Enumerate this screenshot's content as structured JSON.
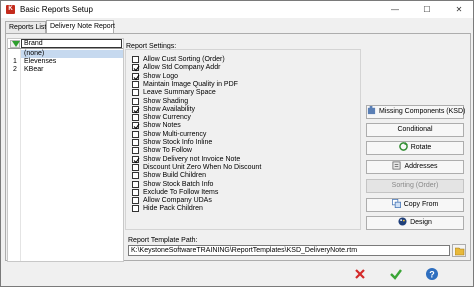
{
  "window": {
    "title": "Basic Reports Setup",
    "min_glyph": "—",
    "max_glyph": "☐",
    "close_glyph": "✕"
  },
  "tabs": [
    {
      "label": "Reports List",
      "active": false
    },
    {
      "label": "Delivery Note Report",
      "active": true
    }
  ],
  "brand_list": {
    "header": "Brand",
    "rows": [
      {
        "num": "",
        "name": "(none)",
        "selected": true
      },
      {
        "num": "1",
        "name": "Elevenses",
        "selected": false
      },
      {
        "num": "2",
        "name": "KBear",
        "selected": false
      }
    ]
  },
  "settings": {
    "group_label": "Report Settings:",
    "options": [
      {
        "label": "Allow Cust Sorting (Order)",
        "checked": false
      },
      {
        "label": "Allow Std Company Addr",
        "checked": true
      },
      {
        "label": "Show Logo",
        "checked": true
      },
      {
        "label": "Maintain Image Quality in PDF",
        "checked": false
      },
      {
        "label": "Leave Summary Space",
        "checked": false
      },
      {
        "label": "Show Shading",
        "checked": false
      },
      {
        "label": "Show Availability",
        "checked": true
      },
      {
        "label": "Show Currency",
        "checked": false
      },
      {
        "label": "Show Notes",
        "checked": true
      },
      {
        "label": "Show Multi-currency",
        "checked": false
      },
      {
        "label": "Show Stock Info Inline",
        "checked": false
      },
      {
        "label": "Show To Follow",
        "checked": false
      },
      {
        "label": "Show Delivery not Invoice Note",
        "checked": true
      },
      {
        "label": "Discount Unit Zero When No Discount",
        "checked": false
      },
      {
        "label": "Show Build Children",
        "checked": false
      },
      {
        "label": "Show Stock Batch Info",
        "checked": false
      },
      {
        "label": "Exclude To Follow Items",
        "checked": false
      },
      {
        "label": "Allow Company UDAs",
        "checked": false
      },
      {
        "label": "Hide Pack Children",
        "checked": false
      }
    ]
  },
  "buttons": {
    "missing_components": "Missing Components (KSD)",
    "conditional": "Conditional",
    "rotate": "Rotate",
    "addresses": "Addresses",
    "sorting": "Sorting (Order)",
    "copy_from": "Copy From",
    "design": "Design"
  },
  "template": {
    "label": "Report Template Path:",
    "path": "K:\\KeystoneSoftwareTRAINING\\ReportTemplates\\KSD_DeliveryNote.rtm"
  },
  "colors": {
    "accent": "#c42b1c",
    "selection": "#c6d9ef",
    "ok_green": "#3aa536",
    "cancel_red": "#d42a2a"
  },
  "icons": {
    "cancel": "cancel-x-icon",
    "ok": "ok-check-icon",
    "help": "help-question-icon",
    "folder": "folder-open-icon"
  }
}
